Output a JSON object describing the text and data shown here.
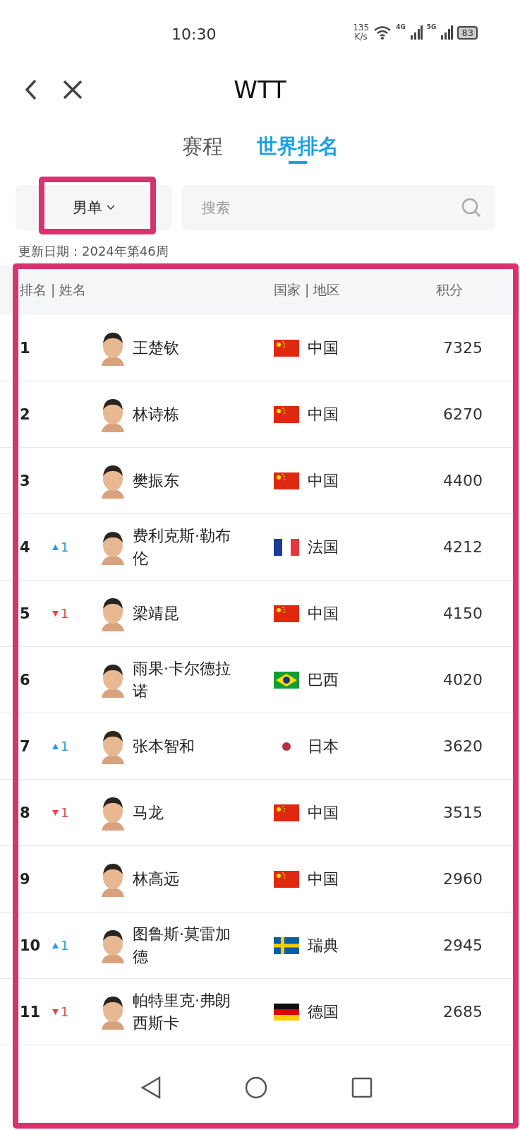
{
  "status_bar": {
    "time": "10:30",
    "speed_value": "135",
    "speed_unit": "K/s",
    "network_1": "4G",
    "network_2": "5G",
    "battery": "83"
  },
  "nav": {
    "title": "WTT"
  },
  "tabs": [
    {
      "label": "赛程",
      "selected": false
    },
    {
      "label": "世界排名",
      "selected": true
    }
  ],
  "filter": {
    "value": "男单",
    "highlighted": true
  },
  "search": {
    "placeholder": "搜索"
  },
  "update_date": "更新日期：2024年第46周",
  "table": {
    "highlighted": true,
    "columns": [
      "排名 | 姓名",
      "国家 | 地区",
      "积分"
    ],
    "rows": [
      {
        "rank": "1",
        "change": null,
        "name": "王楚钦",
        "country": {
          "kind": "cn",
          "name": "中国"
        },
        "points": "7325"
      },
      {
        "rank": "2",
        "change": null,
        "name": "林诗栋",
        "country": {
          "kind": "cn",
          "name": "中国"
        },
        "points": "6270"
      },
      {
        "rank": "3",
        "change": null,
        "name": "樊振东",
        "country": {
          "kind": "cn",
          "name": "中国"
        },
        "points": "4400"
      },
      {
        "rank": "4",
        "change": {
          "kind": "up",
          "amount": "1"
        },
        "name": "费利克斯·勒布伦",
        "country": {
          "kind": "fr",
          "name": "法国"
        },
        "points": "4212"
      },
      {
        "rank": "5",
        "change": {
          "kind": "down",
          "amount": "1"
        },
        "name": "梁靖昆",
        "country": {
          "kind": "cn",
          "name": "中国"
        },
        "points": "4150"
      },
      {
        "rank": "6",
        "change": null,
        "name": "雨果·卡尔德拉诺",
        "country": {
          "kind": "br",
          "name": "巴西"
        },
        "points": "4020"
      },
      {
        "rank": "7",
        "change": {
          "kind": "up",
          "amount": "1"
        },
        "name": "张本智和",
        "country": {
          "kind": "jp",
          "name": "日本"
        },
        "points": "3620"
      },
      {
        "rank": "8",
        "change": {
          "kind": "down",
          "amount": "1"
        },
        "name": "马龙",
        "country": {
          "kind": "cn",
          "name": "中国"
        },
        "points": "3515"
      },
      {
        "rank": "9",
        "change": null,
        "name": "林高远",
        "country": {
          "kind": "cn",
          "name": "中国"
        },
        "points": "2960"
      },
      {
        "rank": "10",
        "change": {
          "kind": "up",
          "amount": "1"
        },
        "name": "图鲁斯·莫雷加德",
        "country": {
          "kind": "se",
          "name": "瑞典"
        },
        "points": "2945"
      },
      {
        "rank": "11",
        "change": {
          "kind": "down",
          "amount": "1"
        },
        "name": "帕特里克·弗朗西斯卡",
        "country": {
          "kind": "de",
          "name": "德国"
        },
        "points": "2685"
      }
    ]
  }
}
